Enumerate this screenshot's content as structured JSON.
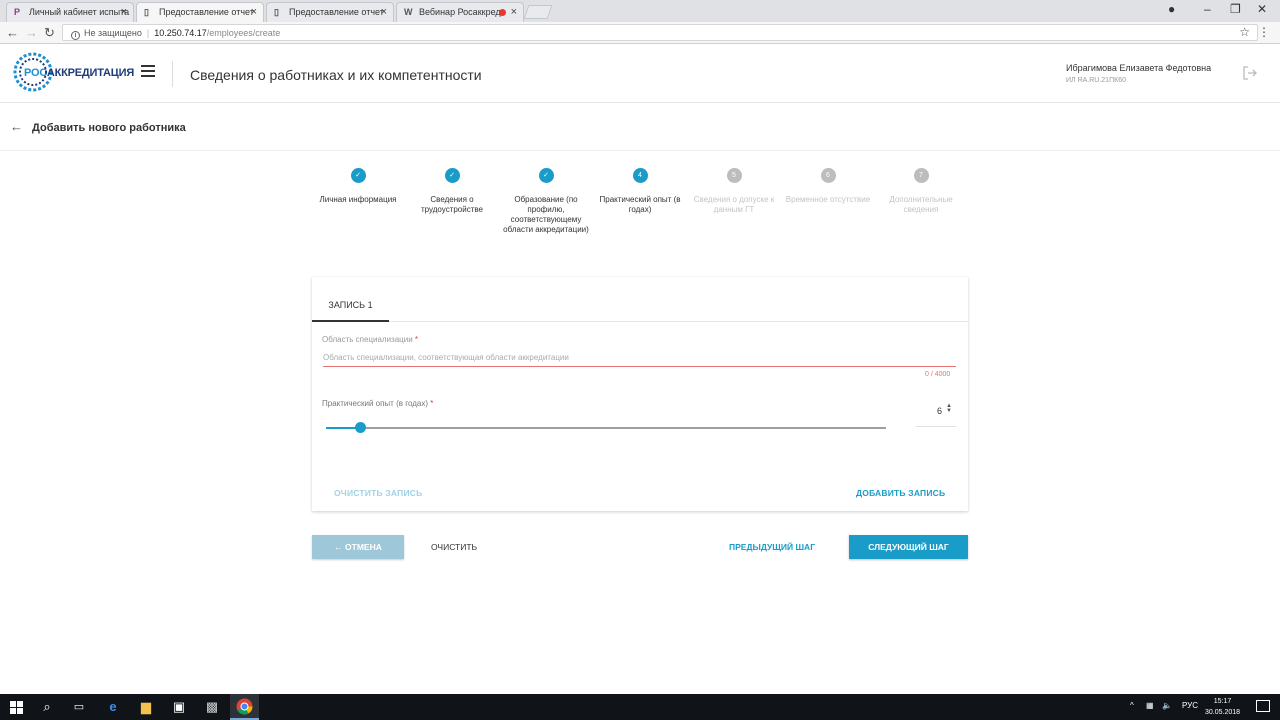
{
  "browser": {
    "tabs": [
      {
        "title": "Личный кабинет испыта"
      },
      {
        "title": "Предоставление отчет"
      },
      {
        "title": "Предоставление отчет"
      },
      {
        "title": "Вебинар Росаккреди"
      }
    ],
    "address": {
      "security": "Не защищено",
      "host": "10.250.74.17",
      "path": "/employees/create"
    }
  },
  "header": {
    "logo_text_ros": "РОС",
    "logo_text_rest": "АККРЕДИТАЦИЯ",
    "title": "Сведения о работниках и их компетентности",
    "user_name": "Ибрагимова Елизавета Федотовна",
    "user_code": "ИЛ RA.RU.21ПК60"
  },
  "subheader": {
    "back_label": "Добавить нового работника"
  },
  "stepper": {
    "steps": [
      {
        "number": "1",
        "label": "Личная информация",
        "state": "done"
      },
      {
        "number": "2",
        "label": "Сведения о трудоустройстве",
        "state": "done"
      },
      {
        "number": "3",
        "label": "Образование (по профилю, соответствующему области аккредитации)",
        "state": "done"
      },
      {
        "number": "4",
        "label": "Практический опыт (в годах)",
        "state": "current"
      },
      {
        "number": "5",
        "label": "Сведения о допуске к данным ГТ",
        "state": "todo"
      },
      {
        "number": "6",
        "label": "Временное отсутствие",
        "state": "todo"
      },
      {
        "number": "7",
        "label": "Дополнительные сведения",
        "state": "todo"
      }
    ]
  },
  "form": {
    "record_tab": "ЗАПИСЬ 1",
    "area_label": "Область специализации",
    "area_placeholder": "Область специализации, соответствующая области аккредитации",
    "area_value": "",
    "area_counter": "0 / 4000",
    "experience_label": "Практический опыт (в годах)",
    "experience_value": "6",
    "experience_fraction": 0.06,
    "required_mark": "*",
    "clear_record": "ОЧИСТИТЬ ЗАПИСЬ",
    "add_record": "ДОБАВИТЬ ЗАПИСЬ"
  },
  "actions": {
    "cancel": "ОТМЕНА",
    "clear": "ОЧИСТИТЬ",
    "prev_step": "ПРЕДЫДУЩИЙ ШАГ",
    "next_step": "СЛЕДУЮЩИЙ ШАГ"
  },
  "taskbar": {
    "lang": "РУС",
    "time": "15:17",
    "date": "30.05.2018"
  },
  "colors": {
    "accent": "#1a9cc9",
    "error": "#e57373",
    "disabled_step": "#bdbdbd"
  }
}
